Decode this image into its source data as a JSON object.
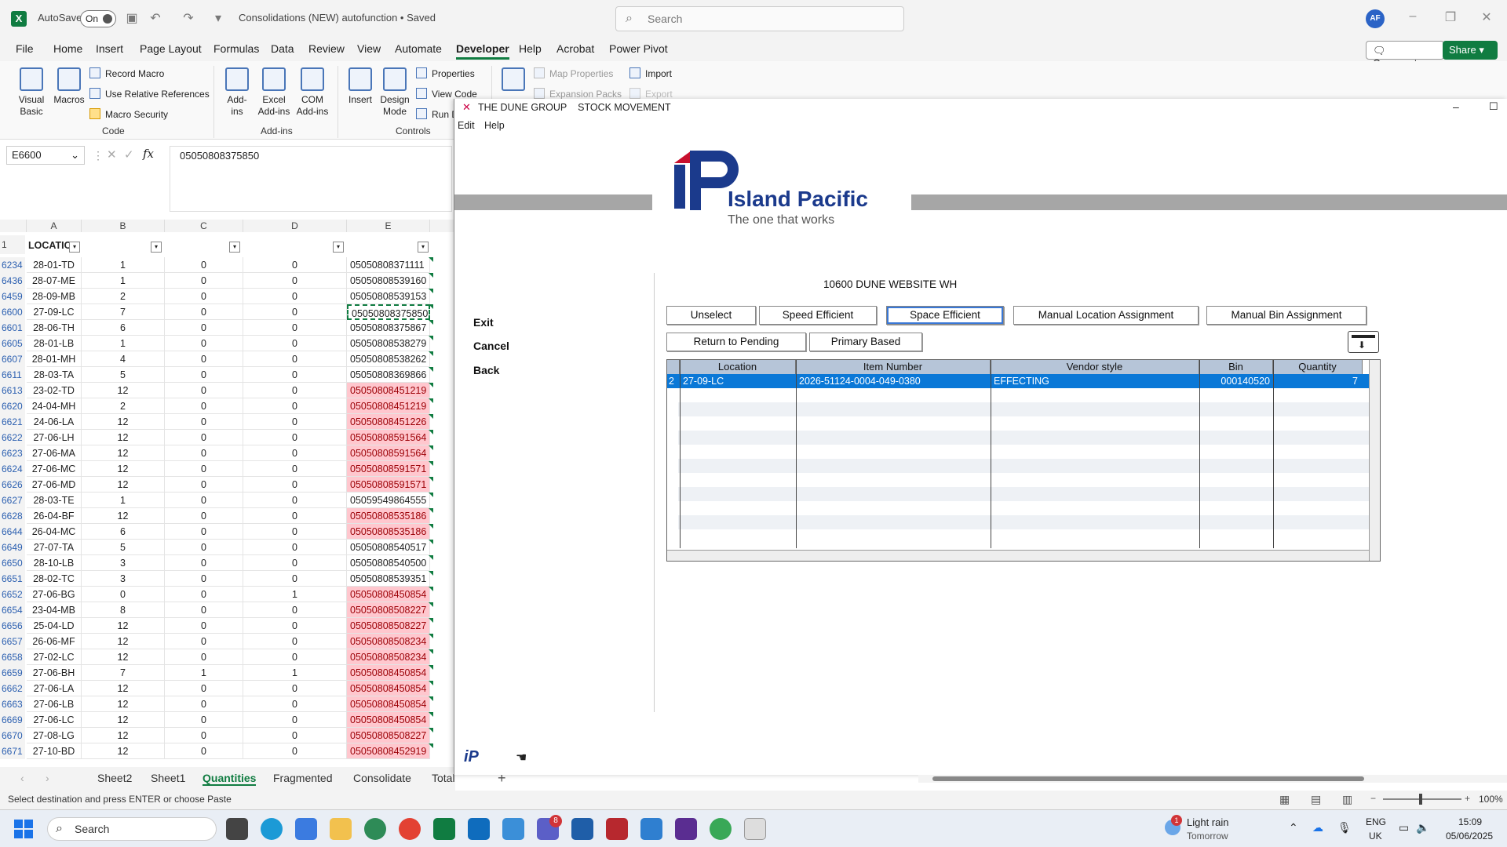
{
  "titlebar": {
    "autosave_label": "AutoSave",
    "autosave_state": "On",
    "doc_title": "Consolidations (NEW) autofunction • Saved",
    "search_placeholder": "Search",
    "avatar": "AF"
  },
  "ribbon_tabs": [
    "File",
    "Home",
    "Insert",
    "Page Layout",
    "Formulas",
    "Data",
    "Review",
    "View",
    "Automate",
    "Developer",
    "Help",
    "Acrobat",
    "Power Pivot"
  ],
  "comments_label": "Comments",
  "share_label": "Share",
  "ribbon": {
    "visual_basic": "Visual Basic",
    "macros": "Macros",
    "record_macro": "Record Macro",
    "use_relative": "Use Relative References",
    "macro_security": "Macro Security",
    "code_group": "Code",
    "addins": "Add-ins",
    "excel_addins": "Excel Add-ins",
    "com_addins": "COM Add-ins",
    "addins_group": "Add-ins",
    "insert": "Insert",
    "design_mode": "Design Mode",
    "properties": "Properties",
    "view_code": "View Code",
    "run_dialog": "Run D",
    "controls_group": "Controls",
    "map_properties": "Map Properties",
    "expansion_packs": "Expansion Packs",
    "import": "Import",
    "export": "Export"
  },
  "formula": {
    "namebox": "E6600",
    "value": "05050808375850"
  },
  "columns": [
    "A",
    "B",
    "C",
    "D",
    "E"
  ],
  "header_row": {
    "num": "1",
    "a": "LOCATIO"
  },
  "rows": [
    {
      "n": "6234",
      "a": "28-01-TD",
      "b": "1",
      "c": "0",
      "d": "0",
      "e": "05050808371111",
      "pink": false
    },
    {
      "n": "6436",
      "a": "28-07-ME",
      "b": "1",
      "c": "0",
      "d": "0",
      "e": "05050808539160",
      "pink": false
    },
    {
      "n": "6459",
      "a": "28-09-MB",
      "b": "2",
      "c": "0",
      "d": "0",
      "e": "05050808539153",
      "pink": false
    },
    {
      "n": "6600",
      "a": "27-09-LC",
      "b": "7",
      "c": "0",
      "d": "0",
      "e": "05050808375850",
      "pink": false,
      "sel": true
    },
    {
      "n": "6601",
      "a": "28-06-TH",
      "b": "6",
      "c": "0",
      "d": "0",
      "e": "05050808375867",
      "pink": false
    },
    {
      "n": "6605",
      "a": "28-01-LB",
      "b": "1",
      "c": "0",
      "d": "0",
      "e": "05050808538279",
      "pink": false
    },
    {
      "n": "6607",
      "a": "28-01-MH",
      "b": "4",
      "c": "0",
      "d": "0",
      "e": "05050808538262",
      "pink": false
    },
    {
      "n": "6611",
      "a": "28-03-TA",
      "b": "5",
      "c": "0",
      "d": "0",
      "e": "05050808369866",
      "pink": false
    },
    {
      "n": "6613",
      "a": "23-02-TD",
      "b": "12",
      "c": "0",
      "d": "0",
      "e": "05050808451219",
      "pink": true
    },
    {
      "n": "6620",
      "a": "24-04-MH",
      "b": "2",
      "c": "0",
      "d": "0",
      "e": "05050808451219",
      "pink": true
    },
    {
      "n": "6621",
      "a": "24-06-LA",
      "b": "12",
      "c": "0",
      "d": "0",
      "e": "05050808451226",
      "pink": true
    },
    {
      "n": "6622",
      "a": "27-06-LH",
      "b": "12",
      "c": "0",
      "d": "0",
      "e": "05050808591564",
      "pink": true
    },
    {
      "n": "6623",
      "a": "27-06-MA",
      "b": "12",
      "c": "0",
      "d": "0",
      "e": "05050808591564",
      "pink": true
    },
    {
      "n": "6624",
      "a": "27-06-MC",
      "b": "12",
      "c": "0",
      "d": "0",
      "e": "05050808591571",
      "pink": true
    },
    {
      "n": "6626",
      "a": "27-06-MD",
      "b": "12",
      "c": "0",
      "d": "0",
      "e": "05050808591571",
      "pink": true
    },
    {
      "n": "6627",
      "a": "28-03-TE",
      "b": "1",
      "c": "0",
      "d": "0",
      "e": "05059549864555",
      "pink": false
    },
    {
      "n": "6628",
      "a": "26-04-BF",
      "b": "12",
      "c": "0",
      "d": "0",
      "e": "05050808535186",
      "pink": true
    },
    {
      "n": "6644",
      "a": "26-04-MC",
      "b": "6",
      "c": "0",
      "d": "0",
      "e": "05050808535186",
      "pink": true
    },
    {
      "n": "6649",
      "a": "27-07-TA",
      "b": "5",
      "c": "0",
      "d": "0",
      "e": "05050808540517",
      "pink": false
    },
    {
      "n": "6650",
      "a": "28-10-LB",
      "b": "3",
      "c": "0",
      "d": "0",
      "e": "05050808540500",
      "pink": false
    },
    {
      "n": "6651",
      "a": "28-02-TC",
      "b": "3",
      "c": "0",
      "d": "0",
      "e": "05050808539351",
      "pink": false
    },
    {
      "n": "6652",
      "a": "27-06-BG",
      "b": "0",
      "c": "0",
      "d": "1",
      "e": "05050808450854",
      "pink": true
    },
    {
      "n": "6654",
      "a": "23-04-MB",
      "b": "8",
      "c": "0",
      "d": "0",
      "e": "05050808508227",
      "pink": true
    },
    {
      "n": "6656",
      "a": "25-04-LD",
      "b": "12",
      "c": "0",
      "d": "0",
      "e": "05050808508227",
      "pink": true
    },
    {
      "n": "6657",
      "a": "26-06-MF",
      "b": "12",
      "c": "0",
      "d": "0",
      "e": "05050808508234",
      "pink": true
    },
    {
      "n": "6658",
      "a": "27-02-LC",
      "b": "12",
      "c": "0",
      "d": "0",
      "e": "05050808508234",
      "pink": true
    },
    {
      "n": "6659",
      "a": "27-06-BH",
      "b": "7",
      "c": "1",
      "d": "1",
      "e": "05050808450854",
      "pink": true
    },
    {
      "n": "6662",
      "a": "27-06-LA",
      "b": "12",
      "c": "0",
      "d": "0",
      "e": "05050808450854",
      "pink": true
    },
    {
      "n": "6663",
      "a": "27-06-LB",
      "b": "12",
      "c": "0",
      "d": "0",
      "e": "05050808450854",
      "pink": true
    },
    {
      "n": "6669",
      "a": "27-06-LC",
      "b": "12",
      "c": "0",
      "d": "0",
      "e": "05050808450854",
      "pink": true
    },
    {
      "n": "6670",
      "a": "27-08-LG",
      "b": "12",
      "c": "0",
      "d": "0",
      "e": "05050808508227",
      "pink": true
    },
    {
      "n": "6671",
      "a": "27-10-BD",
      "b": "12",
      "c": "0",
      "d": "0",
      "e": "05050808452919",
      "pink": true
    }
  ],
  "sheet_tabs": [
    "Sheet2",
    "Sheet1",
    "Quantities",
    "Fragmented",
    "Consolidate",
    "Total"
  ],
  "status_text": "Select destination and press ENTER or choose Paste",
  "zoom": "100%",
  "app": {
    "title_company": "THE DUNE GROUP",
    "title_module": "STOCK MOVEMENT",
    "menu": [
      "Edit",
      "Help"
    ],
    "logo_brand": "Island Pacific",
    "logo_tagline": "The one that works",
    "warehouse": "10600 DUNE WEBSITE WH",
    "side_links": [
      "Exit",
      "Cancel",
      "Back"
    ],
    "buttons_row1": [
      "Unselect",
      "Speed Efficient",
      "Space Efficient",
      "Manual Location Assignment",
      "Manual Bin Assignment"
    ],
    "buttons_row2": [
      "Return to Pending",
      "Primary Based"
    ],
    "table_headers": [
      "Location",
      "Item Number",
      "Vendor style",
      "Bin",
      "Quantity"
    ],
    "table_row": {
      "idx": "2",
      "location": "27-09-LC",
      "item": "2026-51124-0004-049-0380",
      "vendor": "EFFECTING",
      "bin": "000140520",
      "qty": "7"
    }
  },
  "taskbar": {
    "search": "Search",
    "weather": "Light rain",
    "weather_sub": "Tomorrow",
    "lang": "ENG",
    "region": "UK",
    "time": "15:09",
    "date": "05/06/2025",
    "teams_badge": "8",
    "weather_badge": "1"
  }
}
